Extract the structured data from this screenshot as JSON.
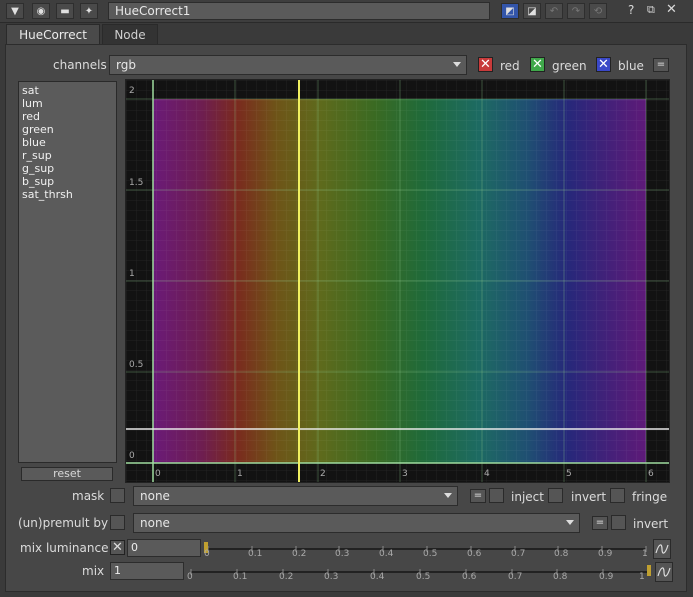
{
  "window": {
    "node_name": "HueCorrect1",
    "help_label": "?"
  },
  "tabs": [
    {
      "label": "HueCorrect"
    },
    {
      "label": "Node"
    }
  ],
  "channels": {
    "label": "channels",
    "value": "rgb",
    "red": "red",
    "green": "green",
    "blue": "blue",
    "eq": "="
  },
  "curves": [
    "sat",
    "lum",
    "red",
    "green",
    "blue",
    "r_sup",
    "g_sup",
    "b_sup",
    "sat_thrsh"
  ],
  "reset_label": "reset",
  "graph": {
    "y_ticks": [
      "2",
      "1.5",
      "1",
      "0.5",
      "0"
    ],
    "x_ticks": [
      "0",
      "1",
      "2",
      "3",
      "4",
      "5",
      "6"
    ]
  },
  "mask": {
    "label": "mask",
    "value": "none",
    "eq": "=",
    "inject": "inject",
    "invert": "invert",
    "fringe": "fringe"
  },
  "premult": {
    "label": "(un)premult by",
    "value": "none",
    "eq": "=",
    "invert": "invert"
  },
  "mix_luminance": {
    "label": "mix luminance",
    "value": "0",
    "ticks": [
      "0",
      "0.1",
      "0.2",
      "0.3",
      "0.4",
      "0.5",
      "0.6",
      "0.7",
      "0.8",
      "0.9",
      "1"
    ]
  },
  "mix": {
    "label": "mix",
    "value": "1",
    "ticks": [
      "0",
      "0.1",
      "0.2",
      "0.3",
      "0.4",
      "0.5",
      "0.6",
      "0.7",
      "0.8",
      "0.9",
      "1"
    ]
  },
  "colors": {
    "red_check": "#c83a3a",
    "green_check": "#3fa84a",
    "blue_check": "#3a48c8",
    "cursor_line": "#f0f060"
  }
}
